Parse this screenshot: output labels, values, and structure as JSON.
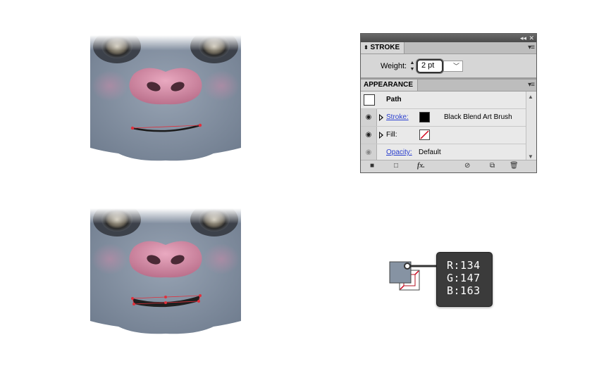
{
  "stroke_panel": {
    "tab": "STROKE",
    "weight_label": "Weight:",
    "weight_value": "2 pt"
  },
  "appearance_panel": {
    "tab": "APPEARANCE",
    "path_label": "Path",
    "stroke_label": "Stroke:",
    "stroke_value": "Black Blend Art Brush",
    "fill_label": "Fill:",
    "opacity_label": "Opacity:",
    "opacity_value": "Default"
  },
  "color_readout": {
    "r": "R:134",
    "g": "G:147",
    "b": "B:163",
    "fill_color": "#8693a3"
  },
  "face": {
    "skin_color": "#8693a3",
    "nose_color": "#c98aa0",
    "mouth_anchor_color": "#e0303c"
  }
}
